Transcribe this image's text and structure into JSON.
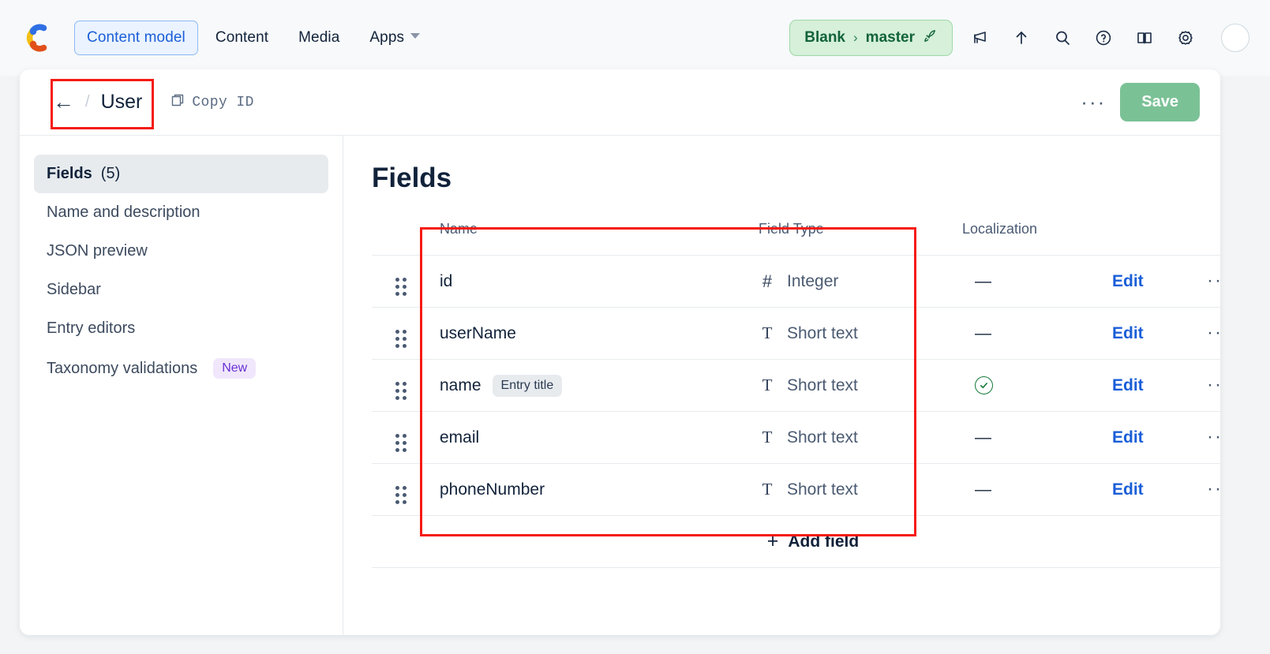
{
  "app": {
    "logo_icon": "contentful-logo-icon",
    "nav_tabs": [
      {
        "label": "Content model",
        "active": true
      },
      {
        "label": "Content",
        "active": false
      },
      {
        "label": "Media",
        "active": false
      },
      {
        "label": "Apps",
        "active": false,
        "has_caret": true
      }
    ],
    "environment": {
      "space": "Blank",
      "separator": "›",
      "env": "master",
      "rocket_icon": "🚀"
    },
    "icons": [
      {
        "name": "megaphone-icon"
      },
      {
        "name": "upload-arrow-icon"
      },
      {
        "name": "search-icon"
      },
      {
        "name": "help-circle-icon"
      },
      {
        "name": "book-icon"
      },
      {
        "name": "gear-icon"
      }
    ],
    "avatar": "user-avatar"
  },
  "content_type_header": {
    "back_arrow": "←",
    "crumb_separator": "/",
    "title": "User",
    "copy_id_label": "Copy ID",
    "copy_id_icon": "copy-icon",
    "more_actions": "···",
    "save_label": "Save"
  },
  "sidebar": {
    "items": [
      {
        "label": "Fields",
        "count": "(5)",
        "active": true,
        "badge": null
      },
      {
        "label": "Name and description",
        "count": "",
        "active": false,
        "badge": null
      },
      {
        "label": "JSON preview",
        "count": "",
        "active": false,
        "badge": null
      },
      {
        "label": "Sidebar",
        "count": "",
        "active": false,
        "badge": null
      },
      {
        "label": "Entry editors",
        "count": "",
        "active": false,
        "badge": null
      },
      {
        "label": "Taxonomy validations",
        "count": "",
        "active": false,
        "badge": "New"
      }
    ]
  },
  "main": {
    "title": "Fields",
    "columns": [
      "",
      "Name",
      "Field Type",
      "Localization",
      "",
      ""
    ],
    "rows": [
      {
        "drag": "drag-handle",
        "name": "id",
        "tag": null,
        "type_icon": "#",
        "type_icon_kind": "number",
        "type": "Integer",
        "localized": false,
        "localization_dash": "—",
        "edit": "Edit",
        "menu": "···"
      },
      {
        "drag": "drag-handle",
        "name": "userName",
        "tag": null,
        "type_icon": "T",
        "type_icon_kind": "text",
        "type": "Short text",
        "localized": false,
        "localization_dash": "—",
        "edit": "Edit",
        "menu": "···"
      },
      {
        "drag": "drag-handle",
        "name": "name",
        "tag": "Entry title",
        "type_icon": "T",
        "type_icon_kind": "text",
        "type": "Short text",
        "localized": true,
        "localization_dash": "✓",
        "edit": "Edit",
        "menu": "···"
      },
      {
        "drag": "drag-handle",
        "name": "email",
        "tag": null,
        "type_icon": "T",
        "type_icon_kind": "text",
        "type": "Short text",
        "localized": false,
        "localization_dash": "—",
        "edit": "Edit",
        "menu": "···"
      },
      {
        "drag": "drag-handle",
        "name": "phoneNumber",
        "tag": null,
        "type_icon": "T",
        "type_icon_kind": "text",
        "type": "Short text",
        "localized": false,
        "localization_dash": "—",
        "edit": "Edit",
        "menu": "···"
      }
    ],
    "add_field_label": "Add field",
    "add_field_plus": "+"
  },
  "annotations": [
    {
      "name": "breadcrumb-highlight",
      "color": "#f51b13"
    },
    {
      "name": "fields-table-highlight",
      "color": "#f51b13"
    }
  ]
}
